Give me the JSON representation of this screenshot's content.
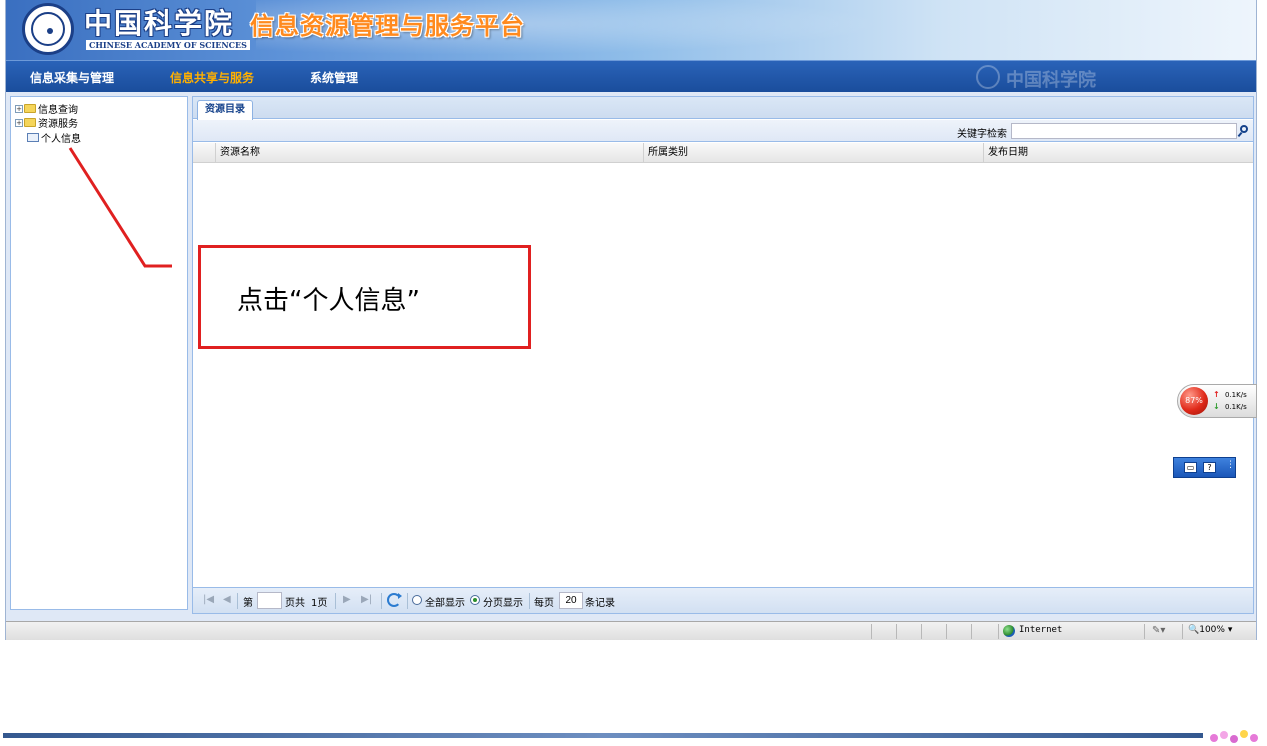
{
  "banner": {
    "org_name_cn": "中国科学院",
    "org_name_en": "CHINESE ACADEMY OF SCIENCES",
    "platform_title": "信息资源管理与服务平台"
  },
  "nav": {
    "items": [
      {
        "label": "信息采集与管理",
        "active": false
      },
      {
        "label": "信息共享与服务",
        "active": true
      },
      {
        "label": "系统管理",
        "active": false
      }
    ],
    "watermark": "中国科学院"
  },
  "tree": {
    "items": [
      {
        "label": "信息查询",
        "type": "folder",
        "expandable": true
      },
      {
        "label": "资源服务",
        "type": "folder",
        "expandable": true
      },
      {
        "label": "个人信息",
        "type": "leaf",
        "expandable": false
      }
    ]
  },
  "main": {
    "tab_label": "资源目录",
    "search": {
      "label": "关键字检索",
      "value": "",
      "placeholder": ""
    },
    "columns": [
      "资源名称",
      "所属类别",
      "发布日期"
    ],
    "paging": {
      "page_prefix": "第",
      "page_value": "",
      "page_suffix": "页共",
      "total_pages": "1页",
      "show_all_label": "全部显示",
      "paged_label": "分页显示",
      "per_page_label": "每页",
      "per_page_value": "20",
      "records_label": "条记录",
      "mode": "paged"
    }
  },
  "statusbar": {
    "zone": "Internet",
    "zoom": "100%"
  },
  "annotation": {
    "text": "点击“个人信息”",
    "color": "#e02020"
  },
  "net_widget": {
    "percent": "87%",
    "up": "0.1K/s",
    "down": "0.1K/s"
  },
  "colors": {
    "nav_bg": "#1a4d9c",
    "nav_active": "#ffb000",
    "title_orange": "#ff8a1e",
    "panel_border": "#99bbe8"
  }
}
